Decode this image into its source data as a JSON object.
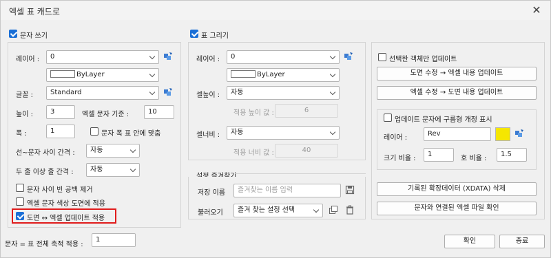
{
  "window": {
    "title": "엑셀 표 캐드로"
  },
  "text_panel": {
    "header": "문자 쓰기",
    "layer_label": "레이어 :",
    "layer_value": "0",
    "color_value": "ByLayer",
    "font_label": "글꼴 :",
    "font_value": "Standard",
    "height_label": "높이 :",
    "height_value": "3",
    "excel_base_label": "엑셀 문자 기준 :",
    "excel_base_value": "10",
    "width_label": "폭 :",
    "width_value": "1",
    "fit_label": "문자 폭 표 안에 맞춤",
    "line_gap_label": "선~문자 사이 간격 :",
    "line_gap_value": "자동",
    "row_gap_label": "두 줄 이상 줄 간격 :",
    "row_gap_value": "자동",
    "remove_space_label": "문자 사이 빈 공백 제거",
    "excel_color_label": "엑셀 문자 색상 도면에 적용",
    "sync_label": "도면 ↔ 엑셀 업데이트 적용"
  },
  "table_panel": {
    "header": "표 그리기",
    "layer_label": "레이어 :",
    "layer_value": "0",
    "color_value": "ByLayer",
    "cell_height_label": "셀높이 :",
    "cell_height_value": "자동",
    "applied_height_label": "적용 높이 값 :",
    "applied_height_value": "6",
    "cell_width_label": "셀너비 :",
    "cell_width_value": "자동",
    "applied_width_label": "적용 너비 값 :",
    "applied_width_value": "40"
  },
  "favorites": {
    "header": "설정 즐겨찾기",
    "save_name_label": "저장 이름",
    "save_name_placeholder": "즐겨찾는 이름 입력",
    "load_label": "불러오기",
    "load_value": "즐겨 찾는 설정 선택"
  },
  "update_panel": {
    "selected_only_label": "선택한 객체만 업데이트",
    "drawing_to_excel_button": "도면 수정 → 엑셀 내용 업데이트",
    "excel_to_drawing_button": "엑셀 수정 → 도면 내용 업데이트",
    "revcloud_label": "업데이트 문자에 구름형 개정 표시",
    "rev_layer_label": "레이어 :",
    "rev_layer_value": "Rev",
    "scale_label": "크기 비율 :",
    "scale_value": "1",
    "arc_ratio_label": "호 비율 :",
    "arc_ratio_value": "1.5",
    "delete_xdata_button": "기록된 확장데이터 (XDATA) 삭제",
    "check_excel_button": "문자와 연결된 엑셀 파일 확인"
  },
  "footer": {
    "scale_label": "문자 = 표 전체 축적 적용 :",
    "scale_value": "1",
    "ok_button": "확인",
    "close_button": "종료"
  },
  "colors": {
    "accent": "#1a6fd6",
    "highlight": "#e01b1b",
    "rev_color": "#f5e600"
  }
}
